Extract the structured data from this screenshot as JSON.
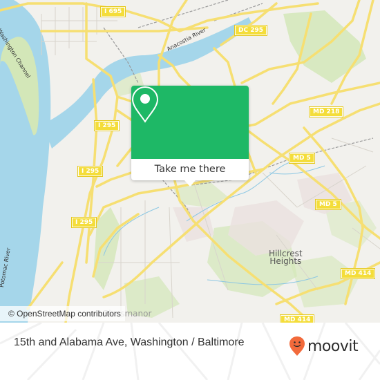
{
  "map": {
    "attribution": "© OpenStreetMap contributors",
    "route_shields": [
      {
        "label": "I 695",
        "name": "shield-i695"
      },
      {
        "label": "DC 295",
        "name": "shield-dc295"
      },
      {
        "label": "MD 218",
        "name": "shield-md218"
      },
      {
        "label": "I 295",
        "name": "shield-i295-a"
      },
      {
        "label": "MD 5",
        "name": "shield-md5-a"
      },
      {
        "label": "I 295",
        "name": "shield-i295-b"
      },
      {
        "label": "MD 5",
        "name": "shield-md5-b"
      },
      {
        "label": "I 295",
        "name": "shield-i295-c"
      },
      {
        "label": "MD 414",
        "name": "shield-md414-a"
      },
      {
        "label": "MD 414",
        "name": "shield-md414-b"
      }
    ],
    "labels": {
      "washington_channel": "Washington Channel",
      "anacostia_river": "Anacostia River",
      "potomac_river": "Potomac River",
      "hillcrest": "Hillcrest",
      "heights": "Heights",
      "glassmanor": "Glassmanor"
    },
    "colors": {
      "land": "#f2f1ed",
      "water": "#a5d6ea",
      "park": "#cfe5b0",
      "road": "#f6e07a",
      "shield": "#f4dd3a"
    }
  },
  "popup": {
    "button_label": "Take me there",
    "icon": "map-pin-icon",
    "color": "#1eb866"
  },
  "footer": {
    "title": "15th and Alabama Ave, Washington / Baltimore",
    "brand": "moovit",
    "brand_color": "#f26a3b"
  }
}
